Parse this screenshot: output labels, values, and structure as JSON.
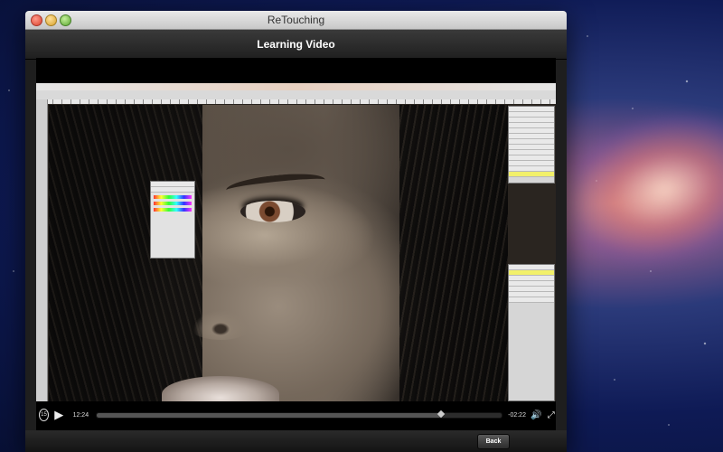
{
  "window": {
    "title": "ReTouching"
  },
  "header": {
    "title": "Learning Video"
  },
  "player": {
    "rewind_label": "15",
    "elapsed": "12:24",
    "remaining": "-02:22",
    "progress": 0.85
  },
  "footer": {
    "back_label": "Back"
  },
  "icons": {
    "rewind": "rewind-15-icon",
    "play": "play-icon",
    "volume": "volume-icon",
    "fullscreen": "fullscreen-icon"
  }
}
